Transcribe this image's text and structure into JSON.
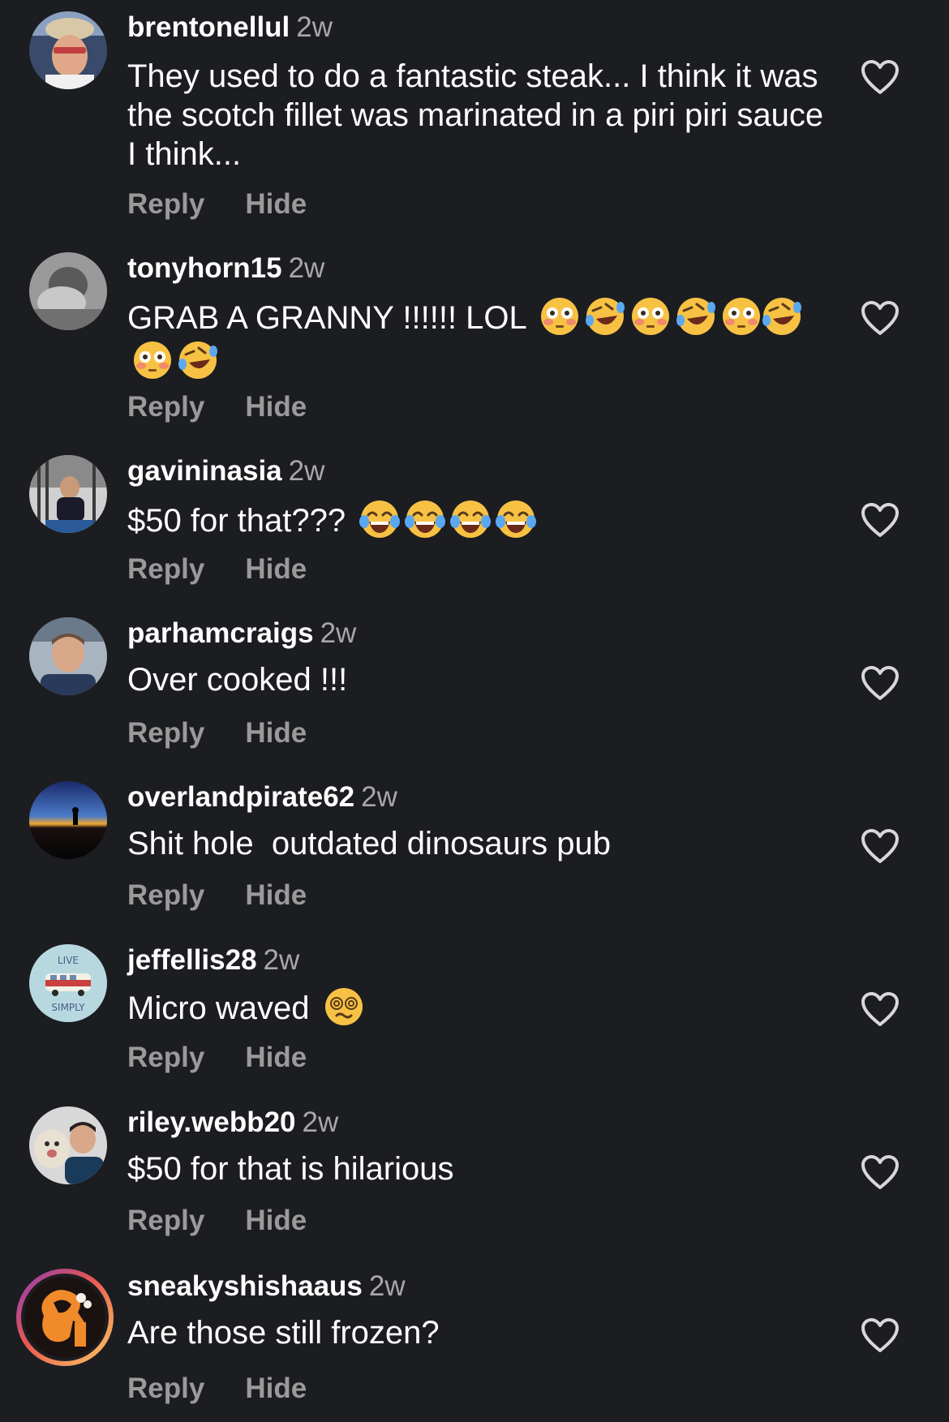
{
  "comments": [
    {
      "username": "brentonellul",
      "time": "2w",
      "text": "They used to do a fantastic steak... I think it was the scotch fillet was marinated in a piri piri sauce I think...",
      "reply_label": "Reply",
      "hide_label": "Hide"
    },
    {
      "username": "tonyhorn15",
      "time": "2w",
      "text": "GRAB A GRANNY !!!!!! LOL",
      "emojis": [
        "flushed-face",
        "rolling-laughing-face",
        "flushed-face",
        "rolling-laughing-face",
        "flushed-face",
        "rolling-laughing-face",
        "flushed-face",
        "rolling-laughing-face"
      ],
      "reply_label": "Reply",
      "hide_label": "Hide"
    },
    {
      "username": "gavininasia",
      "time": "2w",
      "text": "$50 for that???",
      "emojis": [
        "tears-of-joy-face",
        "tears-of-joy-face",
        "tears-of-joy-face",
        "tears-of-joy-face"
      ],
      "reply_label": "Reply",
      "hide_label": "Hide"
    },
    {
      "username": "parhamcraigs",
      "time": "2w",
      "text": "Over cooked !!!",
      "reply_label": "Reply",
      "hide_label": "Hide"
    },
    {
      "username": "overlandpirate62",
      "time": "2w",
      "text": "Shit hole  outdated dinosaurs pub",
      "reply_label": "Reply",
      "hide_label": "Hide"
    },
    {
      "username": "jeffellis28",
      "time": "2w",
      "text": "Micro waved",
      "emojis": [
        "dizzy-face"
      ],
      "avatar_text_top": "LIVE",
      "avatar_text_bottom": "SIMPLY",
      "reply_label": "Reply",
      "hide_label": "Hide"
    },
    {
      "username": "riley.webb20",
      "time": "2w",
      "text": "$50 for that is hilarious",
      "reply_label": "Reply",
      "hide_label": "Hide"
    },
    {
      "username": "sneakyshishaaus",
      "time": "2w",
      "text": "Are those still frozen?",
      "reply_label": "Reply",
      "hide_label": "Hide"
    }
  ],
  "icons": {
    "like": "heart-outline-icon"
  },
  "colors": {
    "background": "#1c1d21",
    "text": "#ffffff",
    "secondary": "#a8a8a8",
    "action": "#9a9a9a"
  }
}
